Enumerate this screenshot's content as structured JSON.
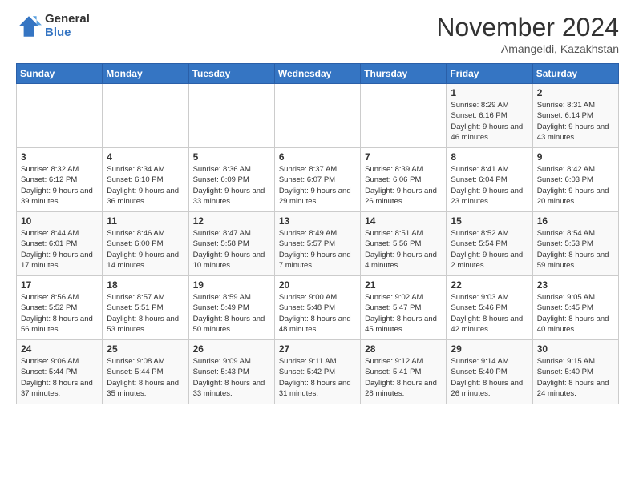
{
  "header": {
    "logo_general": "General",
    "logo_blue": "Blue",
    "title": "November 2024",
    "location": "Amangeldi, Kazakhstan"
  },
  "weekdays": [
    "Sunday",
    "Monday",
    "Tuesday",
    "Wednesday",
    "Thursday",
    "Friday",
    "Saturday"
  ],
  "weeks": [
    [
      {
        "day": "",
        "info": ""
      },
      {
        "day": "",
        "info": ""
      },
      {
        "day": "",
        "info": ""
      },
      {
        "day": "",
        "info": ""
      },
      {
        "day": "",
        "info": ""
      },
      {
        "day": "1",
        "info": "Sunrise: 8:29 AM\nSunset: 6:16 PM\nDaylight: 9 hours and 46 minutes."
      },
      {
        "day": "2",
        "info": "Sunrise: 8:31 AM\nSunset: 6:14 PM\nDaylight: 9 hours and 43 minutes."
      }
    ],
    [
      {
        "day": "3",
        "info": "Sunrise: 8:32 AM\nSunset: 6:12 PM\nDaylight: 9 hours and 39 minutes."
      },
      {
        "day": "4",
        "info": "Sunrise: 8:34 AM\nSunset: 6:10 PM\nDaylight: 9 hours and 36 minutes."
      },
      {
        "day": "5",
        "info": "Sunrise: 8:36 AM\nSunset: 6:09 PM\nDaylight: 9 hours and 33 minutes."
      },
      {
        "day": "6",
        "info": "Sunrise: 8:37 AM\nSunset: 6:07 PM\nDaylight: 9 hours and 29 minutes."
      },
      {
        "day": "7",
        "info": "Sunrise: 8:39 AM\nSunset: 6:06 PM\nDaylight: 9 hours and 26 minutes."
      },
      {
        "day": "8",
        "info": "Sunrise: 8:41 AM\nSunset: 6:04 PM\nDaylight: 9 hours and 23 minutes."
      },
      {
        "day": "9",
        "info": "Sunrise: 8:42 AM\nSunset: 6:03 PM\nDaylight: 9 hours and 20 minutes."
      }
    ],
    [
      {
        "day": "10",
        "info": "Sunrise: 8:44 AM\nSunset: 6:01 PM\nDaylight: 9 hours and 17 minutes."
      },
      {
        "day": "11",
        "info": "Sunrise: 8:46 AM\nSunset: 6:00 PM\nDaylight: 9 hours and 14 minutes."
      },
      {
        "day": "12",
        "info": "Sunrise: 8:47 AM\nSunset: 5:58 PM\nDaylight: 9 hours and 10 minutes."
      },
      {
        "day": "13",
        "info": "Sunrise: 8:49 AM\nSunset: 5:57 PM\nDaylight: 9 hours and 7 minutes."
      },
      {
        "day": "14",
        "info": "Sunrise: 8:51 AM\nSunset: 5:56 PM\nDaylight: 9 hours and 4 minutes."
      },
      {
        "day": "15",
        "info": "Sunrise: 8:52 AM\nSunset: 5:54 PM\nDaylight: 9 hours and 2 minutes."
      },
      {
        "day": "16",
        "info": "Sunrise: 8:54 AM\nSunset: 5:53 PM\nDaylight: 8 hours and 59 minutes."
      }
    ],
    [
      {
        "day": "17",
        "info": "Sunrise: 8:56 AM\nSunset: 5:52 PM\nDaylight: 8 hours and 56 minutes."
      },
      {
        "day": "18",
        "info": "Sunrise: 8:57 AM\nSunset: 5:51 PM\nDaylight: 8 hours and 53 minutes."
      },
      {
        "day": "19",
        "info": "Sunrise: 8:59 AM\nSunset: 5:49 PM\nDaylight: 8 hours and 50 minutes."
      },
      {
        "day": "20",
        "info": "Sunrise: 9:00 AM\nSunset: 5:48 PM\nDaylight: 8 hours and 48 minutes."
      },
      {
        "day": "21",
        "info": "Sunrise: 9:02 AM\nSunset: 5:47 PM\nDaylight: 8 hours and 45 minutes."
      },
      {
        "day": "22",
        "info": "Sunrise: 9:03 AM\nSunset: 5:46 PM\nDaylight: 8 hours and 42 minutes."
      },
      {
        "day": "23",
        "info": "Sunrise: 9:05 AM\nSunset: 5:45 PM\nDaylight: 8 hours and 40 minutes."
      }
    ],
    [
      {
        "day": "24",
        "info": "Sunrise: 9:06 AM\nSunset: 5:44 PM\nDaylight: 8 hours and 37 minutes."
      },
      {
        "day": "25",
        "info": "Sunrise: 9:08 AM\nSunset: 5:44 PM\nDaylight: 8 hours and 35 minutes."
      },
      {
        "day": "26",
        "info": "Sunrise: 9:09 AM\nSunset: 5:43 PM\nDaylight: 8 hours and 33 minutes."
      },
      {
        "day": "27",
        "info": "Sunrise: 9:11 AM\nSunset: 5:42 PM\nDaylight: 8 hours and 31 minutes."
      },
      {
        "day": "28",
        "info": "Sunrise: 9:12 AM\nSunset: 5:41 PM\nDaylight: 8 hours and 28 minutes."
      },
      {
        "day": "29",
        "info": "Sunrise: 9:14 AM\nSunset: 5:40 PM\nDaylight: 8 hours and 26 minutes."
      },
      {
        "day": "30",
        "info": "Sunrise: 9:15 AM\nSunset: 5:40 PM\nDaylight: 8 hours and 24 minutes."
      }
    ]
  ]
}
